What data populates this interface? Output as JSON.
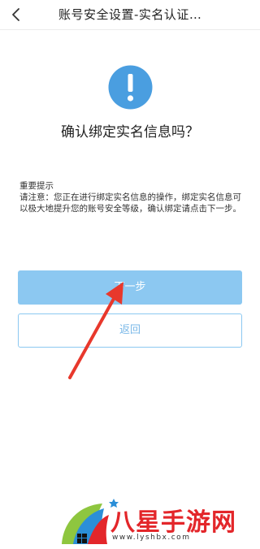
{
  "header": {
    "title": "账号安全设置-实名认证…",
    "back_icon": "chevron-left-icon"
  },
  "dialog": {
    "icon": "exclamation-icon",
    "icon_color": "#4a9ee0",
    "question": "确认绑定实名信息吗？"
  },
  "tips": {
    "title": "重要提示",
    "body": "请注意：您正在进行绑定实名信息的操作，绑定实名信息可以极大地提升您的账号安全等级，确认绑定请点击下一步。"
  },
  "buttons": {
    "next_label": "下一步",
    "back_label": "返回"
  },
  "annotation": {
    "arrow_color": "#e8382c"
  },
  "watermark": {
    "brand": "八星手游网",
    "url": "www.lyshbx.com"
  }
}
